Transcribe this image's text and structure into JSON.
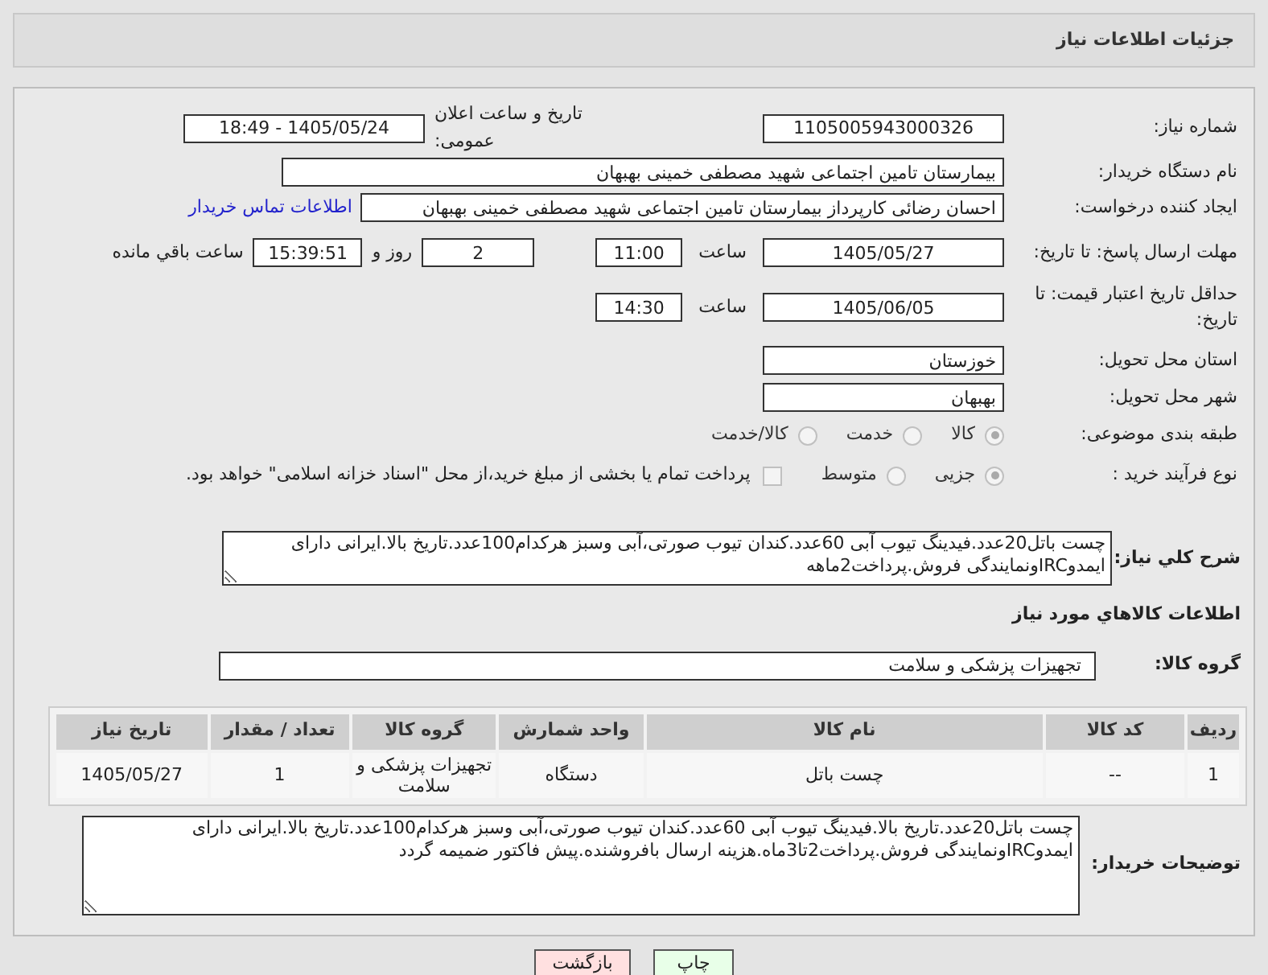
{
  "header": {
    "title": "جزئیات اطلاعات نیاز"
  },
  "need_number": {
    "label": "شماره نیاز:",
    "value": "1105005943000326"
  },
  "announce": {
    "label": "تاریخ و ساعت اعلان عمومی:",
    "value": "1405/05/24 - 18:49"
  },
  "buyer_org": {
    "label": "نام دستگاه خریدار:",
    "value": "بیمارستان تامین اجتماعی شهید مصطفی خمینی بهبهان"
  },
  "requester": {
    "label": "ایجاد کننده درخواست:",
    "value": "احسان رضائی کارپرداز بیمارستان تامین اجتماعی شهید مصطفی خمینی بهبهان",
    "link": "اطلاعات تماس خریدار"
  },
  "deadline": {
    "label": "مهلت ارسال پاسخ: تا تاریخ:",
    "date": "1405/05/27",
    "time_label": "ساعت",
    "time": "11:00",
    "days": "2",
    "days_label": "روز و",
    "remaining": "15:39:51",
    "remaining_label": "ساعت باقي مانده"
  },
  "validity": {
    "label": "حداقل تاریخ اعتبار قیمت: تا تاریخ:",
    "date": "1405/06/05",
    "time_label": "ساعت",
    "time": "14:30"
  },
  "province": {
    "label": "استان محل تحویل:",
    "value": "خوزستان"
  },
  "city": {
    "label": "شهر محل تحویل:",
    "value": "بهبهان"
  },
  "category": {
    "label": "طبقه بندی موضوعی:",
    "options": [
      {
        "label": "کالا",
        "selected": true
      },
      {
        "label": "خدمت",
        "selected": false
      },
      {
        "label": "کالا/خدمت",
        "selected": false
      }
    ]
  },
  "process": {
    "label": "نوع فرآیند خرید :",
    "options": [
      {
        "label": "جزیی",
        "selected": true
      },
      {
        "label": "متوسط",
        "selected": false
      }
    ],
    "payment": {
      "checked": false,
      "note": "پرداخت تمام یا بخشی از مبلغ خرید،از محل \"اسناد خزانه اسلامی\" خواهد بود."
    }
  },
  "description": {
    "label": "شرح کلي نیاز:",
    "value": "چست باتل20عدد.فیدینگ تیوب آبی 60عدد.کندان تیوب صورتی،آبی وسبز هرکدام100عدد.تاریخ بالا.ایرانی دارای ایمدوIRCونمایندگی فروش.پرداخت2ماهه"
  },
  "goods_title": "اطلاعات کالاهاي مورد نیاز",
  "goods_group": {
    "label": "گروه کالا:",
    "value": "تجهیزات پزشکی و سلامت"
  },
  "table": {
    "columns": [
      "ردیف",
      "کد کالا",
      "نام کالا",
      "واحد شمارش",
      "گروه کالا",
      "تعداد / مقدار",
      "تاریخ نیاز"
    ],
    "rows": [
      [
        "1",
        "--",
        "چست باتل",
        "دستگاه",
        "تجهیزات پزشکی و سلامت",
        "1",
        "1405/05/27"
      ]
    ]
  },
  "buyer_notes": {
    "label": "توضیحات خریدار:",
    "value": "چست باتل20عدد.تاریخ بالا.فیدینگ تیوب آبی 60عدد.کندان تیوب صورتی،آبی وسبز هرکدام100عدد.تاریخ بالا.ایرانی دارای ایمدوIRCونمایندگی فروش.پرداخت2تا3ماه.هزینه ارسال بافروشنده.پیش فاکتور ضمیمه گردد"
  },
  "buttons": [
    {
      "label": "چاپ",
      "kind": "print"
    },
    {
      "label": "بازگشت",
      "kind": "back"
    }
  ]
}
